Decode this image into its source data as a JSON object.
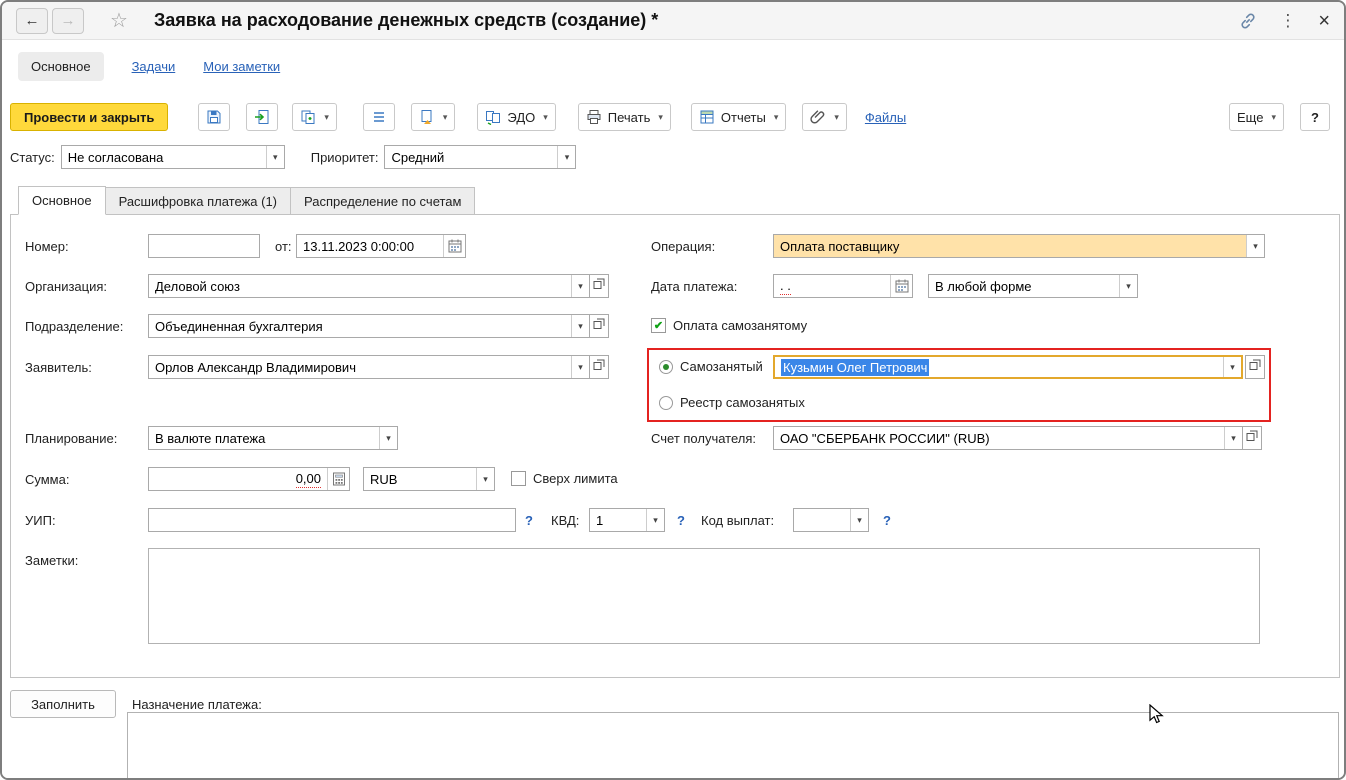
{
  "window": {
    "title": "Заявка на расходование денежных средств (создание) *"
  },
  "icons": {
    "back": "←",
    "forward": "→",
    "favorite": "☆",
    "menu": "⋮",
    "close": "×",
    "dropdown": "▾",
    "check": "✔",
    "question": "?"
  },
  "nav": {
    "main": "Основное",
    "tasks": "Задачи",
    "notes": "Мои заметки"
  },
  "toolbar": {
    "post_and_close": "Провести и закрыть",
    "edo": "ЭДО",
    "print": "Печать",
    "reports": "Отчеты",
    "files": "Файлы",
    "more": "Еще",
    "help": "?"
  },
  "status_row": {
    "status_label": "Статус:",
    "status_value": "Не согласована",
    "priority_label": "Приоритет:",
    "priority_value": "Средний"
  },
  "tabs": {
    "main": "Основное",
    "decoding": "Расшифровка платежа (1)",
    "distribution": "Распределение по счетам"
  },
  "form": {
    "number_label": "Номер:",
    "from_label": "от:",
    "date_value": "13.11.2023 0:00:00",
    "operation_label": "Операция:",
    "operation_value": "Оплата поставщику",
    "organization_label": "Организация:",
    "organization_value": "Деловой союз",
    "payment_date_label": "Дата платежа:",
    "payment_date_placeholder": ". .",
    "payment_form_value": "В любой форме",
    "department_label": "Подразделение:",
    "department_value": "Объединенная бухгалтерия",
    "pay_self_employed_label": "Оплата самозанятому",
    "applicant_label": "Заявитель:",
    "applicant_value": "Орлов Александр Владимирович",
    "self_employed_label": "Самозанятый",
    "self_employed_value": "Кузьмин Олег Петрович",
    "registry_label": "Реестр самозанятых",
    "planning_label": "Планирование:",
    "planning_value": "В валюте платежа",
    "recipient_account_label": "Счет получателя:",
    "recipient_account_value": "ОАО \"СБЕРБАНК РОССИИ\" (RUB)",
    "amount_label": "Сумма:",
    "amount_value": "0,00",
    "currency_value": "RUB",
    "over_limit_label": "Сверх лимита",
    "uip_label": "УИП:",
    "kvd_label": "КВД:",
    "kvd_value": "1",
    "payout_code_label": "Код выплат:",
    "notes_label": "Заметки:"
  },
  "footer": {
    "fill_button": "Заполнить",
    "purpose_label": "Назначение платежа:"
  }
}
